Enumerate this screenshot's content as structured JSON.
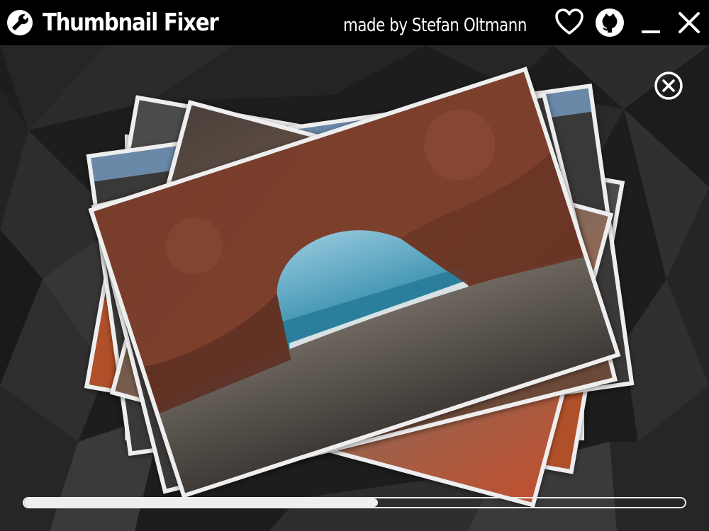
{
  "window": {
    "title": "Thumbnail Fixer",
    "credit": "made by Stefan Oltmann"
  },
  "titlebar_buttons": [
    {
      "name": "heart-icon",
      "action": "donate"
    },
    {
      "name": "github-icon",
      "action": "open-github"
    },
    {
      "name": "minimize-icon",
      "action": "minimize"
    },
    {
      "name": "close-icon",
      "action": "close"
    }
  ],
  "photo_stack": {
    "count_visible": 8,
    "front_photo": "rock-arch-beach"
  },
  "progress": {
    "fraction": 0.535
  },
  "colors": {
    "titlebar": "#000000",
    "background": "#1e1e1e",
    "frame": "#eeeeee",
    "progress": "#eeeeee"
  }
}
